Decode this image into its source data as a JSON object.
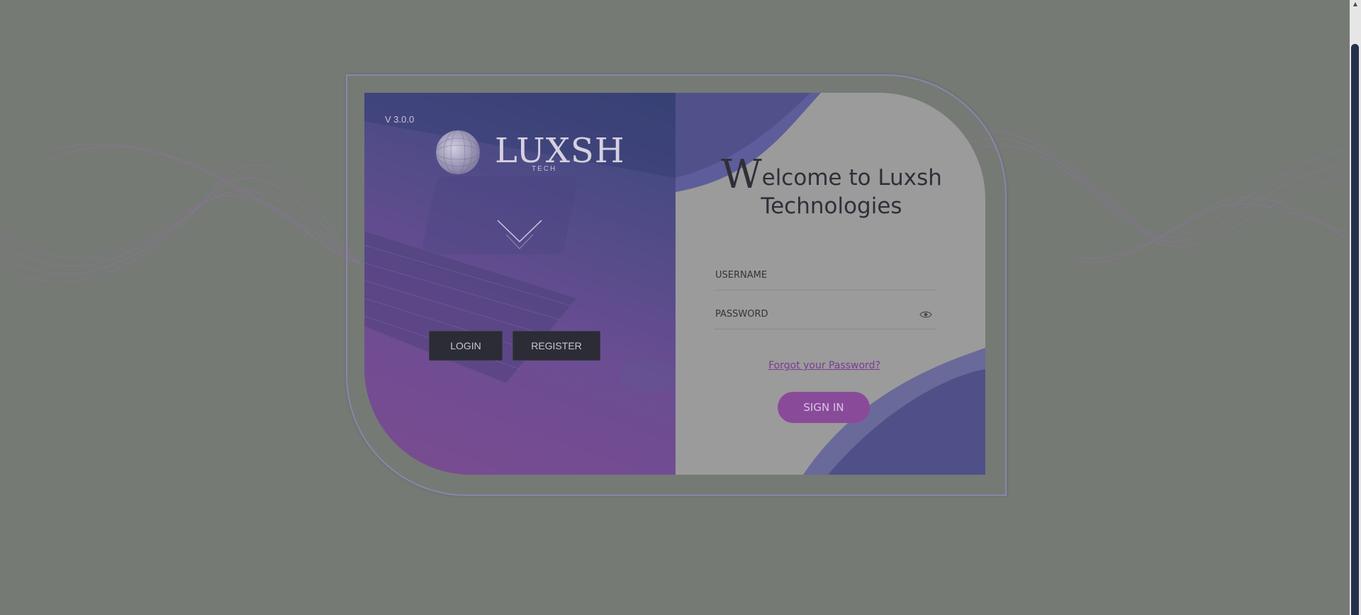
{
  "left_panel": {
    "version": "V 3.0.0",
    "logo_text": "LUXSH",
    "logo_sub": "TECH",
    "login_label": "LOGIN",
    "register_label": "REGISTER"
  },
  "right_panel": {
    "welcome_cap": "W",
    "welcome_rest_line1": "elcome to Luxsh",
    "welcome_line2": "Technologies",
    "username_placeholder": "USERNAME",
    "password_placeholder": "PASSWORD",
    "forgot_label": "Forgot your Password?",
    "signin_label": "SIGN IN",
    "eye_icon": "eye-icon"
  },
  "colors": {
    "page_background": "#757a75",
    "accent": "#8a4a9a",
    "button_dark": "#2b2c36",
    "scrollbar_thumb": "#24314a"
  }
}
